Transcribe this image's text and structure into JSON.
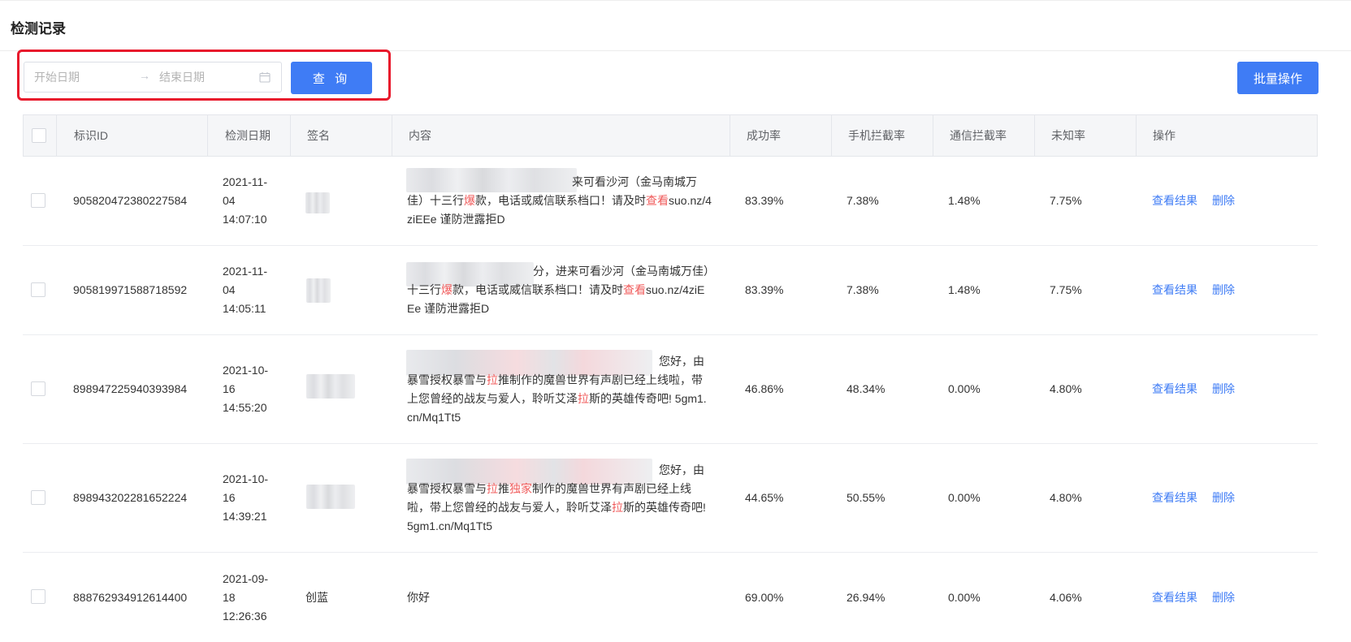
{
  "page": {
    "title": "检测记录"
  },
  "filter": {
    "start_placeholder": "开始日期",
    "end_placeholder": "结束日期",
    "separator": "→",
    "query_label": "查 询",
    "batch_label": "批量操作"
  },
  "table": {
    "columns": [
      "标识ID",
      "检测日期",
      "签名",
      "内容",
      "成功率",
      "手机拦截率",
      "通信拦截率",
      "未知率",
      "操作"
    ],
    "rows": [
      {
        "id": "905820472380227584",
        "date": "2021-11-04 14:07:10",
        "date_lines": [
          "2021-11-",
          "04",
          "14:07:10"
        ],
        "signature": "",
        "content_parts": [
          {
            "t": "来可看沙河（金马南城万佳）十三行",
            "red": false
          },
          {
            "t": "爆",
            "red": true
          },
          {
            "t": "款，电话或威信联系档口！请及时",
            "red": false
          },
          {
            "t": "查看",
            "red": true
          },
          {
            "t": "suo.nz/4ziEEe 谨防泄露拒D",
            "red": false
          }
        ],
        "success": "83.39%",
        "phone_block": "7.38%",
        "telecom_block": "1.48%",
        "unknown": "7.75%",
        "view_label": "查看结果",
        "delete_label": "删除"
      },
      {
        "id": "905819971588718592",
        "date": "2021-11-04 14:05:11",
        "date_lines": [
          "2021-11-",
          "04",
          "14:05:11"
        ],
        "signature": "",
        "content_parts": [
          {
            "t": "分，进来可看沙河（金马南城万佳）十三行",
            "red": false
          },
          {
            "t": "爆",
            "red": true
          },
          {
            "t": "款，电话或威信联系档口！请及时",
            "red": false
          },
          {
            "t": "查看",
            "red": true
          },
          {
            "t": "suo.nz/4ziEEe 谨防泄露拒D",
            "red": false
          }
        ],
        "success": "83.39%",
        "phone_block": "7.38%",
        "telecom_block": "1.48%",
        "unknown": "7.75%",
        "view_label": "查看结果",
        "delete_label": "删除"
      },
      {
        "id": "898947225940393984",
        "date": "2021-10-16 14:55:20",
        "date_lines": [
          "2021-10-",
          "16",
          "14:55:20"
        ],
        "signature": "",
        "content_parts": [
          {
            "t": "您好，由暴雪授权暴雪与",
            "red": false
          },
          {
            "t": "拉",
            "red": true
          },
          {
            "t": "推制作的魔兽世界有声剧已经上线啦，带上您曾经的战友与爱人，聆听艾泽",
            "red": false
          },
          {
            "t": "拉",
            "red": true
          },
          {
            "t": "斯的英雄传奇吧! 5gm1.cn/Mq1Tt5",
            "red": false
          }
        ],
        "success": "46.86%",
        "phone_block": "48.34%",
        "telecom_block": "0.00%",
        "unknown": "4.80%",
        "view_label": "查看结果",
        "delete_label": "删除"
      },
      {
        "id": "898943202281652224",
        "date": "2021-10-16 14:39:21",
        "date_lines": [
          "2021-10-",
          "16",
          "14:39:21"
        ],
        "signature": "",
        "content_parts": [
          {
            "t": "您好，由暴雪授权暴雪与",
            "red": false
          },
          {
            "t": "拉",
            "red": true
          },
          {
            "t": "推",
            "red": false
          },
          {
            "t": "独家",
            "red": true
          },
          {
            "t": "制作的魔兽世界有声剧已经上线啦，带上您曾经的战友与爱人，聆听艾泽",
            "red": false
          },
          {
            "t": "拉",
            "red": true
          },
          {
            "t": "斯的英雄传奇吧! 5gm1.cn/Mq1Tt5",
            "red": false
          }
        ],
        "success": "44.65%",
        "phone_block": "50.55%",
        "telecom_block": "0.00%",
        "unknown": "4.80%",
        "view_label": "查看结果",
        "delete_label": "删除"
      },
      {
        "id": "888762934912614400",
        "date": "2021-09-18 12:26:36",
        "date_lines": [
          "2021-09-",
          "18",
          "12:26:36"
        ],
        "signature": "创蓝",
        "content_parts": [
          {
            "t": "你好",
            "red": false
          }
        ],
        "success": "69.00%",
        "phone_block": "26.94%",
        "telecom_block": "0.00%",
        "unknown": "4.06%",
        "view_label": "查看结果",
        "delete_label": "删除"
      }
    ]
  },
  "colors": {
    "primary": "#3f7cf5",
    "highlight": "#e8192c",
    "keyword": "#f05a5a"
  }
}
